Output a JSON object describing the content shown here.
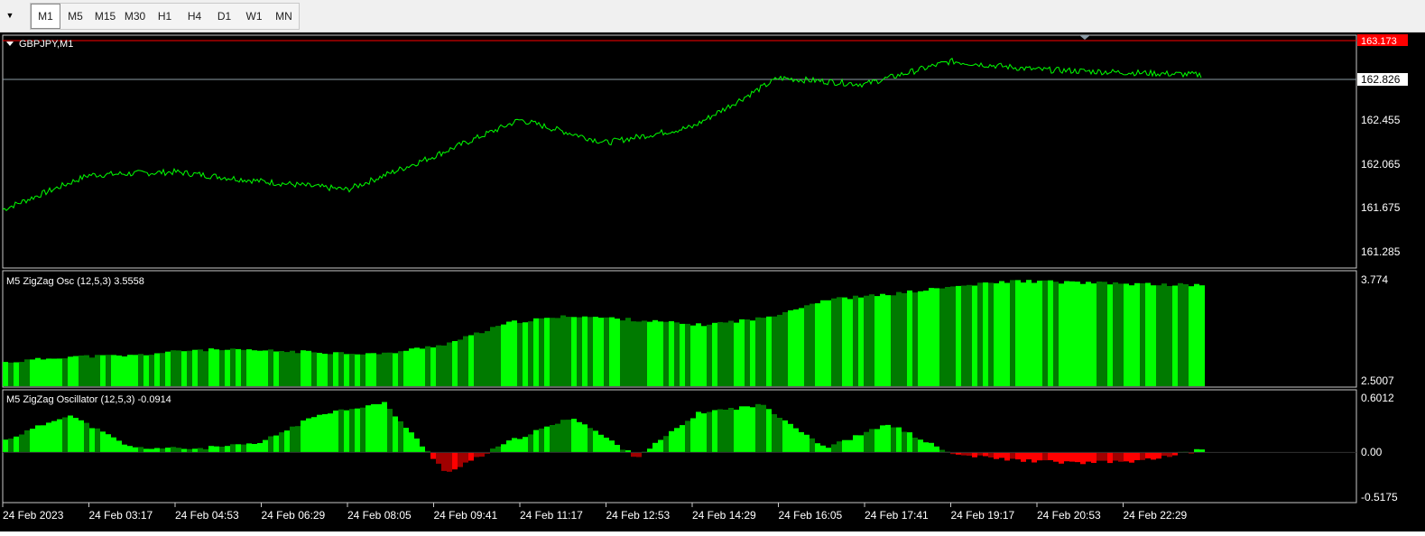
{
  "toolbar": {
    "dropdown_icon": "triangle-down-icon",
    "timeframes": [
      "M1",
      "M5",
      "M15",
      "M30",
      "H1",
      "H4",
      "D1",
      "W1",
      "MN"
    ],
    "active": "M1"
  },
  "price_chart": {
    "title": "GBPJPY,M1",
    "current_price": "162.826",
    "high_marker": "163.173",
    "y_ticks": [
      "162.455",
      "162.065",
      "161.675",
      "161.285"
    ]
  },
  "osc1": {
    "title": "M5 ZigZag Osc (12,5,3) 3.5558",
    "y_ticks": [
      "3.774",
      "2.5007"
    ]
  },
  "osc2": {
    "title": "M5 ZigZag Oscillator (12,5,3) -0.0914",
    "y_ticks": [
      "0.6012",
      "0.00",
      "-0.5175"
    ]
  },
  "time_axis": [
    "24 Feb 2023",
    "24 Feb 03:17",
    "24 Feb 04:53",
    "24 Feb 06:29",
    "24 Feb 08:05",
    "24 Feb 09:41",
    "24 Feb 11:17",
    "24 Feb 12:53",
    "24 Feb 14:29",
    "24 Feb 16:05",
    "24 Feb 17:41",
    "24 Feb 19:17",
    "24 Feb 20:53",
    "24 Feb 22:29"
  ],
  "colors": {
    "background": "#000000",
    "price_line": "#00ff00",
    "bar_bright": "#00ff00",
    "bar_dark": "#007a00",
    "negative": "#ff0000",
    "negative_dark": "#a00000",
    "marker_red": "#ff0000",
    "grid_line": "#8c9ba6"
  },
  "chart_data": [
    {
      "type": "line",
      "series": [
        {
          "name": "GBPJPY,M1",
          "x": [
            "24 Feb 2023",
            "24 Feb 03:17",
            "24 Feb 04:53",
            "24 Feb 06:29",
            "24 Feb 08:05",
            "24 Feb 09:41",
            "24 Feb 11:17",
            "24 Feb 12:53",
            "24 Feb 14:29",
            "24 Feb 16:05",
            "24 Feb 17:41",
            "24 Feb 19:17",
            "24 Feb 20:53",
            "24 Feb 22:29"
          ],
          "values": [
            161.66,
            161.99,
            162.02,
            161.93,
            161.85,
            162.17,
            162.52,
            162.3,
            162.45,
            162.92,
            162.86,
            163.08,
            163.0,
            162.95
          ]
        }
      ],
      "ylim": [
        161.1,
        163.33
      ]
    },
    {
      "type": "bar",
      "values": [
        2.78,
        2.85,
        2.86,
        2.93,
        2.92,
        2.9,
        2.88,
        3.0,
        3.25,
        3.33,
        3.28,
        3.22,
        3.3,
        3.52,
        3.58,
        3.67,
        3.74,
        3.72,
        3.7,
        3.69
      ],
      "ylim": [
        2.5007,
        3.774
      ]
    },
    {
      "type": "bar",
      "values": [
        0.13,
        0.4,
        0.05,
        0.04,
        0.09,
        0.41,
        0.52,
        -0.22,
        0.12,
        0.37,
        -0.05,
        0.42,
        0.5,
        0.05,
        0.3,
        -0.02,
        -0.08,
        -0.11,
        -0.09,
        0.04
      ],
      "ylim": [
        -0.5175,
        0.6012
      ]
    }
  ]
}
